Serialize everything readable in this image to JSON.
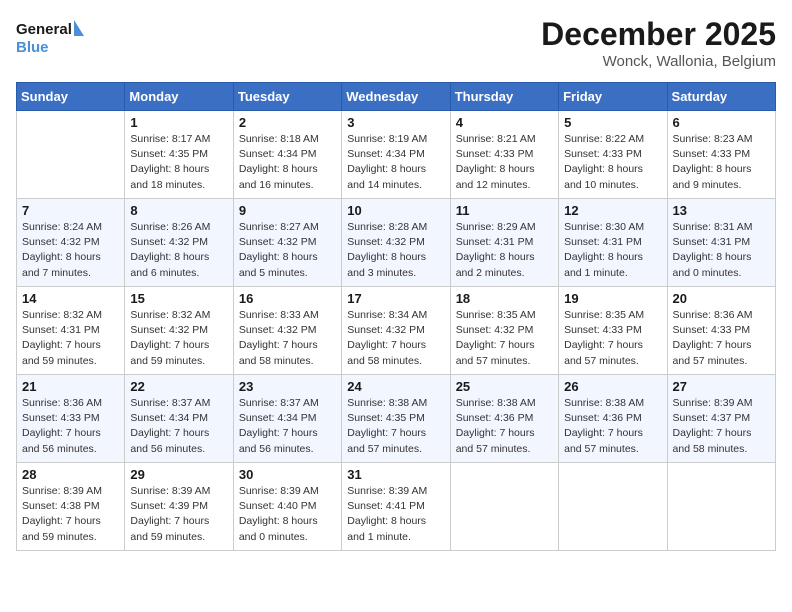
{
  "header": {
    "logo_line1": "General",
    "logo_line2": "Blue",
    "month": "December 2025",
    "location": "Wonck, Wallonia, Belgium"
  },
  "days_of_week": [
    "Sunday",
    "Monday",
    "Tuesday",
    "Wednesday",
    "Thursday",
    "Friday",
    "Saturday"
  ],
  "weeks": [
    [
      {
        "day": "",
        "info": ""
      },
      {
        "day": "1",
        "info": "Sunrise: 8:17 AM\nSunset: 4:35 PM\nDaylight: 8 hours\nand 18 minutes."
      },
      {
        "day": "2",
        "info": "Sunrise: 8:18 AM\nSunset: 4:34 PM\nDaylight: 8 hours\nand 16 minutes."
      },
      {
        "day": "3",
        "info": "Sunrise: 8:19 AM\nSunset: 4:34 PM\nDaylight: 8 hours\nand 14 minutes."
      },
      {
        "day": "4",
        "info": "Sunrise: 8:21 AM\nSunset: 4:33 PM\nDaylight: 8 hours\nand 12 minutes."
      },
      {
        "day": "5",
        "info": "Sunrise: 8:22 AM\nSunset: 4:33 PM\nDaylight: 8 hours\nand 10 minutes."
      },
      {
        "day": "6",
        "info": "Sunrise: 8:23 AM\nSunset: 4:33 PM\nDaylight: 8 hours\nand 9 minutes."
      }
    ],
    [
      {
        "day": "7",
        "info": "Sunrise: 8:24 AM\nSunset: 4:32 PM\nDaylight: 8 hours\nand 7 minutes."
      },
      {
        "day": "8",
        "info": "Sunrise: 8:26 AM\nSunset: 4:32 PM\nDaylight: 8 hours\nand 6 minutes."
      },
      {
        "day": "9",
        "info": "Sunrise: 8:27 AM\nSunset: 4:32 PM\nDaylight: 8 hours\nand 5 minutes."
      },
      {
        "day": "10",
        "info": "Sunrise: 8:28 AM\nSunset: 4:32 PM\nDaylight: 8 hours\nand 3 minutes."
      },
      {
        "day": "11",
        "info": "Sunrise: 8:29 AM\nSunset: 4:31 PM\nDaylight: 8 hours\nand 2 minutes."
      },
      {
        "day": "12",
        "info": "Sunrise: 8:30 AM\nSunset: 4:31 PM\nDaylight: 8 hours\nand 1 minute."
      },
      {
        "day": "13",
        "info": "Sunrise: 8:31 AM\nSunset: 4:31 PM\nDaylight: 8 hours\nand 0 minutes."
      }
    ],
    [
      {
        "day": "14",
        "info": "Sunrise: 8:32 AM\nSunset: 4:31 PM\nDaylight: 7 hours\nand 59 minutes."
      },
      {
        "day": "15",
        "info": "Sunrise: 8:32 AM\nSunset: 4:32 PM\nDaylight: 7 hours\nand 59 minutes."
      },
      {
        "day": "16",
        "info": "Sunrise: 8:33 AM\nSunset: 4:32 PM\nDaylight: 7 hours\nand 58 minutes."
      },
      {
        "day": "17",
        "info": "Sunrise: 8:34 AM\nSunset: 4:32 PM\nDaylight: 7 hours\nand 58 minutes."
      },
      {
        "day": "18",
        "info": "Sunrise: 8:35 AM\nSunset: 4:32 PM\nDaylight: 7 hours\nand 57 minutes."
      },
      {
        "day": "19",
        "info": "Sunrise: 8:35 AM\nSunset: 4:33 PM\nDaylight: 7 hours\nand 57 minutes."
      },
      {
        "day": "20",
        "info": "Sunrise: 8:36 AM\nSunset: 4:33 PM\nDaylight: 7 hours\nand 57 minutes."
      }
    ],
    [
      {
        "day": "21",
        "info": "Sunrise: 8:36 AM\nSunset: 4:33 PM\nDaylight: 7 hours\nand 56 minutes."
      },
      {
        "day": "22",
        "info": "Sunrise: 8:37 AM\nSunset: 4:34 PM\nDaylight: 7 hours\nand 56 minutes."
      },
      {
        "day": "23",
        "info": "Sunrise: 8:37 AM\nSunset: 4:34 PM\nDaylight: 7 hours\nand 56 minutes."
      },
      {
        "day": "24",
        "info": "Sunrise: 8:38 AM\nSunset: 4:35 PM\nDaylight: 7 hours\nand 57 minutes."
      },
      {
        "day": "25",
        "info": "Sunrise: 8:38 AM\nSunset: 4:36 PM\nDaylight: 7 hours\nand 57 minutes."
      },
      {
        "day": "26",
        "info": "Sunrise: 8:38 AM\nSunset: 4:36 PM\nDaylight: 7 hours\nand 57 minutes."
      },
      {
        "day": "27",
        "info": "Sunrise: 8:39 AM\nSunset: 4:37 PM\nDaylight: 7 hours\nand 58 minutes."
      }
    ],
    [
      {
        "day": "28",
        "info": "Sunrise: 8:39 AM\nSunset: 4:38 PM\nDaylight: 7 hours\nand 59 minutes."
      },
      {
        "day": "29",
        "info": "Sunrise: 8:39 AM\nSunset: 4:39 PM\nDaylight: 7 hours\nand 59 minutes."
      },
      {
        "day": "30",
        "info": "Sunrise: 8:39 AM\nSunset: 4:40 PM\nDaylight: 8 hours\nand 0 minutes."
      },
      {
        "day": "31",
        "info": "Sunrise: 8:39 AM\nSunset: 4:41 PM\nDaylight: 8 hours\nand 1 minute."
      },
      {
        "day": "",
        "info": ""
      },
      {
        "day": "",
        "info": ""
      },
      {
        "day": "",
        "info": ""
      }
    ]
  ]
}
